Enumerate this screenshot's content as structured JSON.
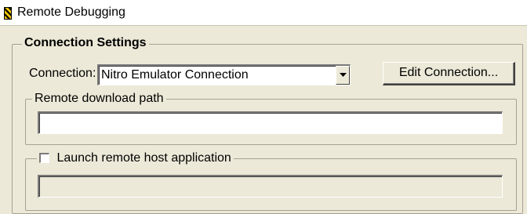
{
  "window": {
    "title": "Remote Debugging"
  },
  "connection_settings": {
    "group_label": "Connection Settings",
    "connection_label": "Connection:",
    "connection_value": "Nitro Emulator Connection",
    "edit_button_label": "Edit Connection..."
  },
  "remote_download": {
    "group_label": "Remote download path",
    "value": "",
    "placeholder": ""
  },
  "launch_remote": {
    "checkbox_label": "Launch remote host application",
    "checked": false,
    "value": ""
  }
}
